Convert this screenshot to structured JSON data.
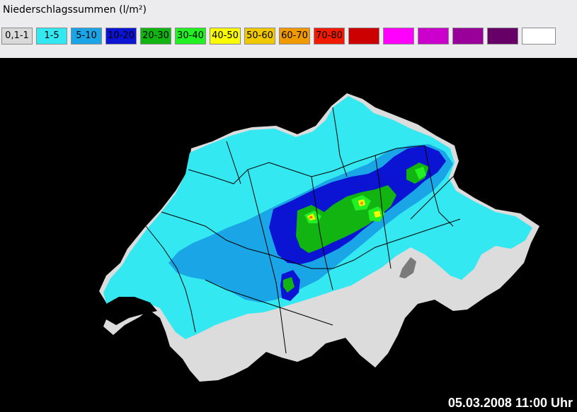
{
  "legend": {
    "title": "Niederschlagssummen (l/m²)",
    "items": [
      {
        "label": "0,1-1",
        "color": "#d9d9d9"
      },
      {
        "label": "1-5",
        "color": "#33e8f0"
      },
      {
        "label": "5-10",
        "color": "#1aa6e6"
      },
      {
        "label": "10-20",
        "color": "#0a14d2"
      },
      {
        "label": "20-30",
        "color": "#12b412"
      },
      {
        "label": "30-40",
        "color": "#22f022"
      },
      {
        "label": "40-50",
        "color": "#fafa00"
      },
      {
        "label": "50-60",
        "color": "#f0c800"
      },
      {
        "label": "60-70",
        "color": "#f09a00"
      },
      {
        "label": "70-80",
        "color": "#f01a00"
      },
      {
        "label": "",
        "color": "#cc0000"
      },
      {
        "label": "",
        "color": "#ff00ff"
      },
      {
        "label": "",
        "color": "#cc00cc"
      },
      {
        "label": "",
        "color": "#990099"
      },
      {
        "label": "",
        "color": "#660066"
      },
      {
        "label": "",
        "color": "#ffffff"
      }
    ]
  },
  "map": {
    "background": "#000000",
    "no_data_color": "#dcdcdc",
    "timestamp": "05.03.2008 11:00 Uhr"
  }
}
